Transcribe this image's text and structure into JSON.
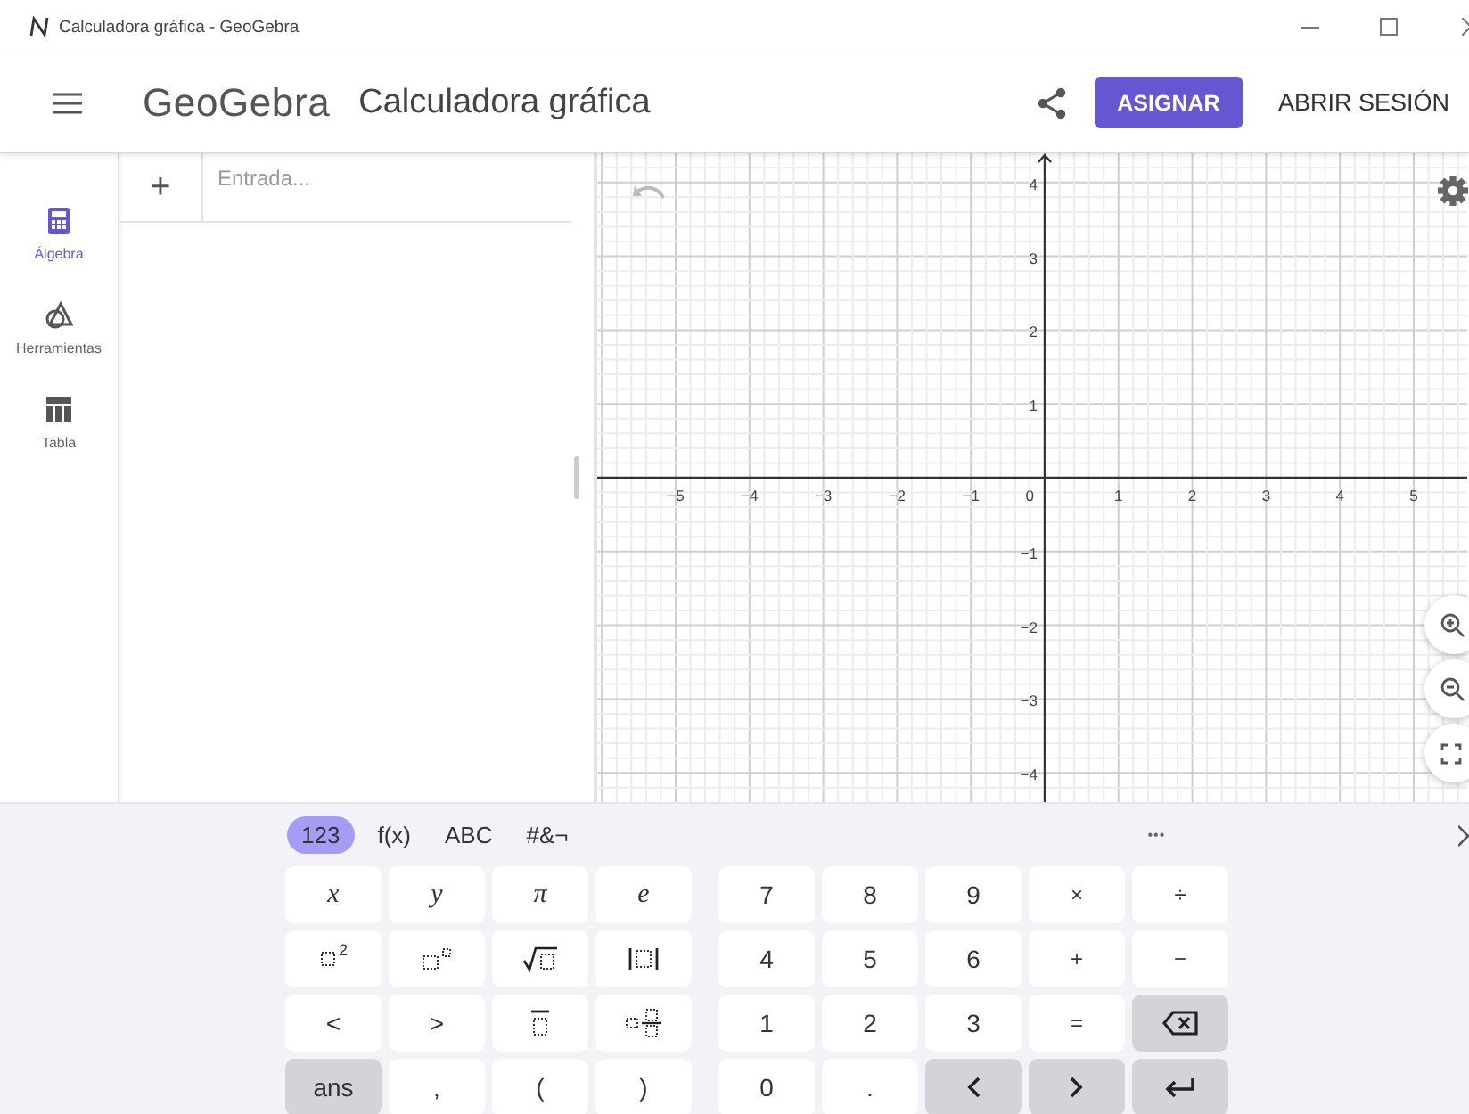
{
  "window": {
    "title": "Calculadora gráfica - GeoGebra"
  },
  "header": {
    "logo": "GeoGebra",
    "app_title": "Calculadora gráfica",
    "assign_button": "ASIGNAR",
    "sign_in": "ABRIR SESIÓN"
  },
  "sidebar": {
    "items": [
      {
        "label": "Álgebra",
        "kind": "calculator",
        "selected": true
      },
      {
        "label": "Herramientas",
        "kind": "shapes",
        "selected": false
      },
      {
        "label": "Tabla",
        "kind": "table",
        "selected": false
      }
    ]
  },
  "algebra": {
    "add": "+",
    "input": {
      "placeholder": "Entrada..."
    }
  },
  "graph": {
    "origin_label": "0",
    "x_labels": [
      "−5",
      "−4",
      "−3",
      "−2",
      "−1",
      "1",
      "2",
      "3",
      "4",
      "5"
    ],
    "y_labels": [
      "4",
      "3",
      "2",
      "1",
      "−1",
      "−2",
      "−3",
      "−4"
    ]
  },
  "keyboard": {
    "tabs": [
      {
        "label": "123",
        "selected": true
      },
      {
        "label": "f(x)",
        "selected": false
      },
      {
        "label": "ABC",
        "selected": false
      },
      {
        "label": "#&¬",
        "selected": false
      }
    ],
    "more": "•••",
    "pads": [
      {
        "rows": [
          {
            "keys": [
              {
                "kind": "math",
                "label": "x",
                "shaded": false
              },
              {
                "kind": "math",
                "label": "y",
                "shaded": false
              },
              {
                "kind": "math",
                "label": "π",
                "shaded": false
              },
              {
                "kind": "math",
                "label": "e",
                "shaded": false
              }
            ]
          },
          {
            "keys": [
              {
                "kind": "squared",
                "label": "2",
                "shaded": false
              },
              {
                "kind": "power",
                "shaded": false
              },
              {
                "kind": "sqrt",
                "shaded": false
              },
              {
                "kind": "abs",
                "shaded": false
              }
            ]
          },
          {
            "keys": [
              {
                "kind": "text",
                "label": "<",
                "shaded": false
              },
              {
                "kind": "text",
                "label": ">",
                "shaded": false
              },
              {
                "kind": "overline",
                "shaded": false
              },
              {
                "kind": "fraction",
                "shaded": false
              }
            ]
          },
          {
            "keys": [
              {
                "kind": "text",
                "label": "ans",
                "shaded": true
              },
              {
                "kind": "text",
                "label": ",",
                "shaded": false
              },
              {
                "kind": "text",
                "label": "(",
                "shaded": false
              },
              {
                "kind": "text",
                "label": ")",
                "shaded": false
              }
            ]
          }
        ]
      },
      {
        "rows": [
          {
            "keys": [
              {
                "kind": "text",
                "label": "7",
                "shaded": false
              },
              {
                "kind": "text",
                "label": "8",
                "shaded": false
              },
              {
                "kind": "text",
                "label": "9",
                "shaded": false
              },
              {
                "kind": "small",
                "label": "×",
                "shaded": false
              },
              {
                "kind": "small",
                "label": "÷",
                "shaded": false
              }
            ]
          },
          {
            "keys": [
              {
                "kind": "text",
                "label": "4",
                "shaded": false
              },
              {
                "kind": "text",
                "label": "5",
                "shaded": false
              },
              {
                "kind": "text",
                "label": "6",
                "shaded": false
              },
              {
                "kind": "small",
                "label": "+",
                "shaded": false
              },
              {
                "kind": "small",
                "label": "−",
                "shaded": false
              }
            ]
          },
          {
            "keys": [
              {
                "kind": "text",
                "label": "1",
                "shaded": false
              },
              {
                "kind": "text",
                "label": "2",
                "shaded": false
              },
              {
                "kind": "text",
                "label": "3",
                "shaded": false
              },
              {
                "kind": "small",
                "label": "=",
                "shaded": false
              },
              {
                "kind": "backspace",
                "shaded": true
              }
            ]
          },
          {
            "keys": [
              {
                "kind": "text",
                "label": "0",
                "shaded": false
              },
              {
                "kind": "text",
                "label": ".",
                "shaded": false
              },
              {
                "kind": "left",
                "shaded": true
              },
              {
                "kind": "right",
                "shaded": true
              },
              {
                "kind": "enter",
                "shaded": true
              }
            ]
          }
        ]
      }
    ]
  }
}
